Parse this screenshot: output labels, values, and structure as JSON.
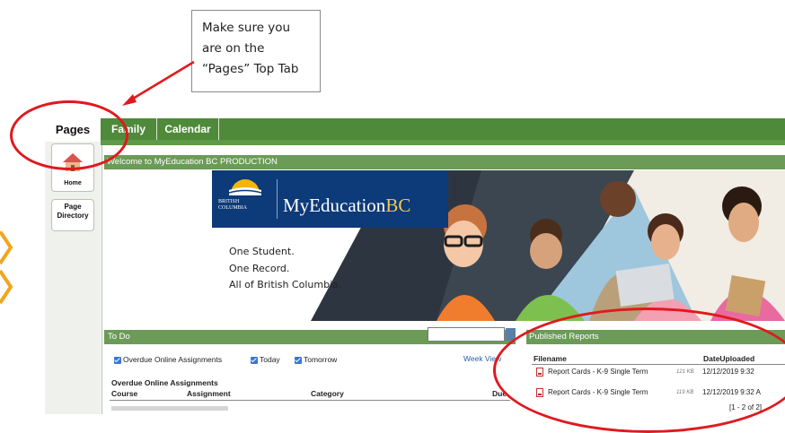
{
  "callout": {
    "lines": [
      "Make sure you",
      "are on the",
      "“Pages” Top Tab"
    ]
  },
  "tabs": {
    "pages": "Pages",
    "family": "Family",
    "calendar": "Calendar"
  },
  "left_nav": {
    "home": "Home",
    "page_directory_line1": "Page",
    "page_directory_line2": "Directory"
  },
  "welcome": "Welcome to MyEducation BC PRODUCTION",
  "banner": {
    "gov_line1": "BRITISH",
    "gov_line2": "COLUMBIA",
    "brand_main": "MyEducation",
    "brand_bc": "BC",
    "tagline": [
      "One Student.",
      "One Record.",
      "All of British Columbia."
    ]
  },
  "todo": {
    "title": "To Do",
    "filters": [
      "Overdue Online Assignments",
      "Today",
      "Tomorrow"
    ],
    "week_view": "Week View",
    "section_title": "Overdue Online Assignments",
    "columns": [
      "Course",
      "Assignment",
      "Category",
      "Due"
    ]
  },
  "published_reports": {
    "title": "Published Reports",
    "columns": [
      "Filename",
      "DateUploaded"
    ],
    "rows": [
      {
        "name": "Report Cards - K-9 Single Term",
        "size": "121 KB",
        "date": "12/12/2019 9:32"
      },
      {
        "name": "Report Cards - K-9 Single Term",
        "size": "119 KB",
        "date": "12/12/2019 9:32 A"
      }
    ],
    "pager": "[1 - 2 of 2]"
  },
  "colors": {
    "tab_green": "#4f8a3a",
    "header_green": "#6b9b56",
    "annotation_red": "#e0191e",
    "brand_blue": "#0d3a78"
  }
}
